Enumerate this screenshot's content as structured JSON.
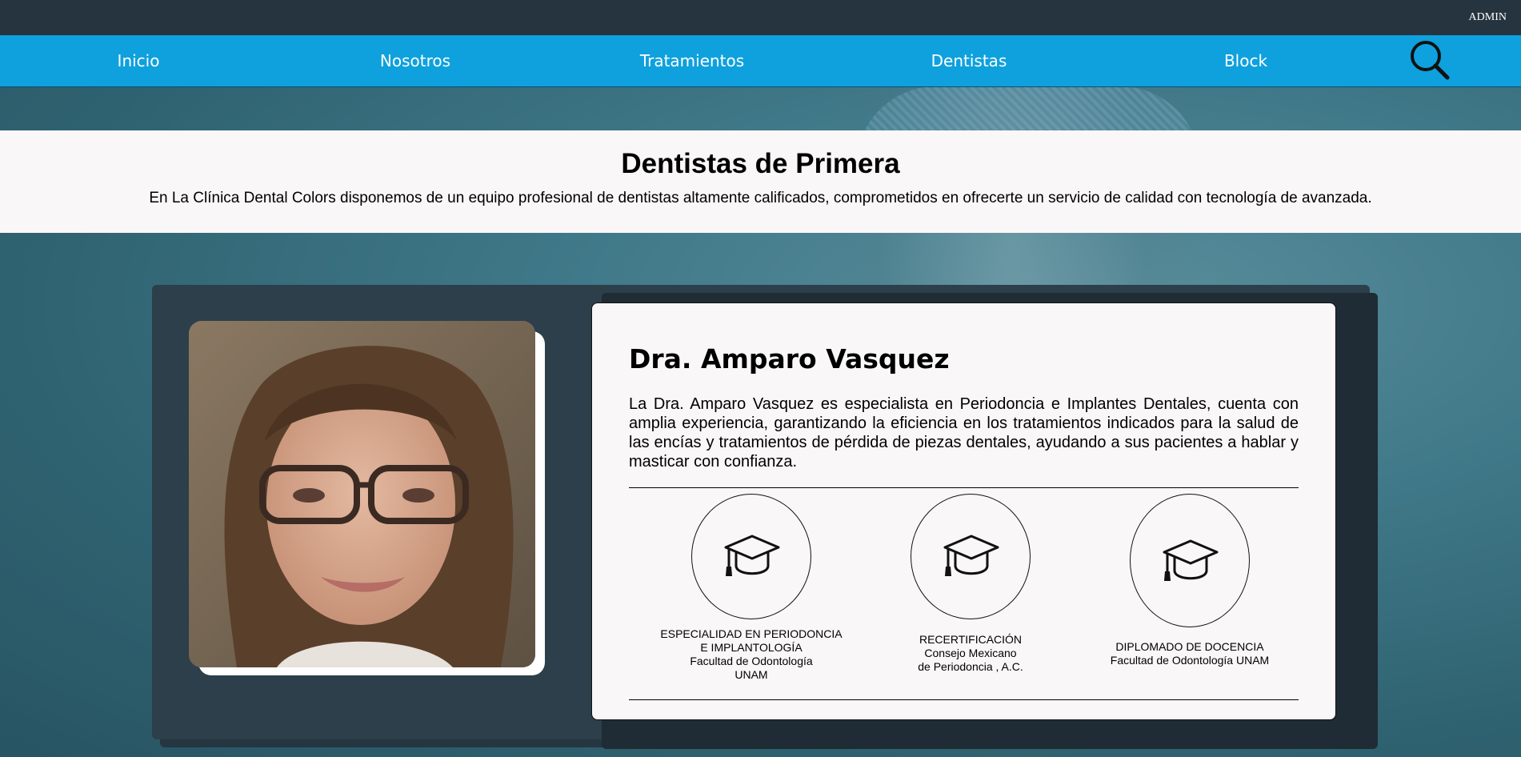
{
  "header": {
    "admin_label": "ADMIN"
  },
  "nav": {
    "items": [
      {
        "label": "Inicio"
      },
      {
        "label": "Nosotros"
      },
      {
        "label": "Tratamientos"
      },
      {
        "label": "Dentistas"
      },
      {
        "label": "Block"
      }
    ],
    "search_icon": "search-icon"
  },
  "intro": {
    "title": "Dentistas de Primera",
    "subtitle": "En La Clínica Dental Colors disponemos de un equipo profesional de dentistas altamente calificados, comprometidos en ofrecerte un servicio de calidad con tecnología de avanzada."
  },
  "dentist": {
    "name": "Dra. Amparo Vasquez",
    "bio": "La Dra. Amparo Vasquez es especialista en Periodoncia e Implantes Dentales, cuenta con amplia experiencia, garantizando la eficiencia en los tratamientos indicados para la salud de las encías y tratamientos de pérdida de piezas dentales, ayudando a sus pacientes a hablar y masticar con confianza.",
    "credentials": [
      {
        "icon": "graduation-cap-icon",
        "lines": [
          "ESPECIALIDAD EN PERIODONCIA",
          "E IMPLANTOLOGÍA",
          "Facultad de Odontología",
          "UNAM"
        ]
      },
      {
        "icon": "graduation-cap-icon",
        "lines": [
          "RECERTIFICACIÓN",
          "Consejo Mexicano",
          "de Periodoncia , A.C."
        ]
      },
      {
        "icon": "graduation-cap-icon",
        "lines": [
          "DIPLOMADO DE DOCENCIA",
          "Facultad de Odontología UNAM"
        ]
      }
    ]
  },
  "colors": {
    "nav_bg": "#0ea1dd",
    "topbar_bg": "#25343f",
    "card_bg": "#2c3f4a",
    "panel_bg": "#f9f7f7"
  }
}
